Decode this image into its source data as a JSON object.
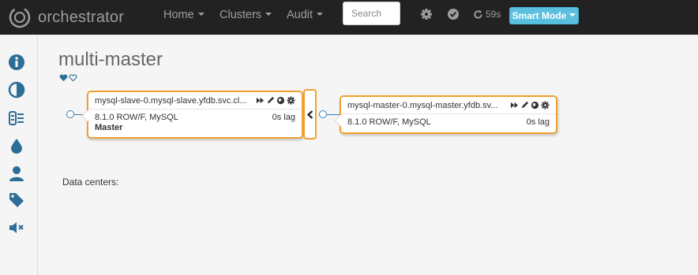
{
  "brand": {
    "name": "orchestrator"
  },
  "nav": {
    "home": "Home",
    "clusters": "Clusters",
    "audit": "Audit",
    "search_placeholder": "Search",
    "refresh_countdown": "59s",
    "mode_button": "Smart Mode"
  },
  "nav_icons": [
    "gear-icon",
    "check-badge-icon",
    "refresh-icon"
  ],
  "sidebar_icons": [
    "info-icon",
    "contrast-icon",
    "list-icon",
    "drop-icon",
    "user-icon",
    "tag-icon",
    "mute-icon"
  ],
  "page": {
    "title": "multi-master",
    "data_centers_label": "Data centers:"
  },
  "instances": [
    {
      "name": "mysql-slave-0.mysql-slave.yfdb.svc.cl...",
      "version": "8.1.0 ROW/F, MySQL",
      "lag": "0s lag",
      "role": "Master"
    },
    {
      "name": "mysql-master-0.mysql-master.yfdb.sv...",
      "version": "8.1.0 ROW/F, MySQL",
      "lag": "0s lag",
      "role": ""
    }
  ],
  "colors": {
    "navbar": "#222222",
    "accent": "#5bc0de",
    "instance_border": "#f0a030",
    "sidebar_icon": "#2c6e96"
  }
}
